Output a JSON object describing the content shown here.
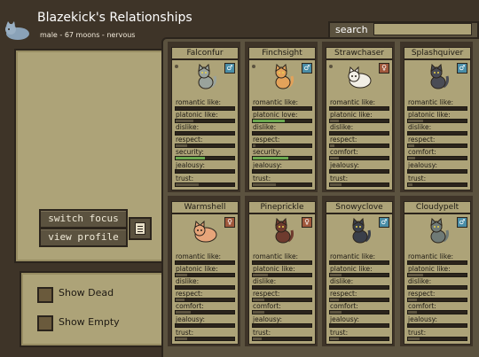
{
  "header": {
    "title": "Blazekick's Relationships",
    "subtitle": "male - 67 moons - nervous"
  },
  "buttons": {
    "switch_focus": "switch focus",
    "view_profile": "view profile"
  },
  "filters": {
    "show_dead": "Show Dead",
    "show_empty": "Show Empty"
  },
  "search": {
    "label": "search",
    "value": ""
  },
  "colors": {
    "bar_empty": "#2b241c",
    "bar_fill": "#5b523f",
    "bar_highlight": "#6aa84f",
    "male": "#4a8da6",
    "female": "#a0583c"
  },
  "cats": [
    {
      "name": "Falconfur",
      "gender": "m",
      "gender_icon": "♂",
      "dot": true,
      "fur": "#9aa39c",
      "sprite": "sitting-cat",
      "relations": [
        {
          "label": "romantic like:",
          "value": 0.0
        },
        {
          "label": "platonic like:",
          "value": 0.3
        },
        {
          "label": "dislike:",
          "value": 0.0
        },
        {
          "label": "respect:",
          "value": 0.2
        },
        {
          "label": "security:",
          "value": 0.5,
          "highlight": true
        },
        {
          "label": "jealousy:",
          "value": 0.0
        },
        {
          "label": "trust:",
          "value": 0.4
        }
      ]
    },
    {
      "name": "Finchsight",
      "gender": "m",
      "gender_icon": "♂",
      "dot": true,
      "fur": "#e3a25a",
      "sprite": "sitting-cat",
      "relations": [
        {
          "label": "romantic like:",
          "value": 0.0
        },
        {
          "label": "platonic love:",
          "value": 0.55,
          "highlight": true
        },
        {
          "label": "dislike:",
          "value": 0.0
        },
        {
          "label": "respect:",
          "value": 0.05
        },
        {
          "label": "security:",
          "value": 0.6,
          "highlight": true
        },
        {
          "label": "jealousy:",
          "value": 0.0
        },
        {
          "label": "trust:",
          "value": 0.4
        }
      ]
    },
    {
      "name": "Strawchaser",
      "gender": "f",
      "gender_icon": "♀",
      "dot": true,
      "fur": "#f2efe6",
      "sprite": "loaf-cat",
      "relations": [
        {
          "label": "romantic like:",
          "value": 0.0
        },
        {
          "label": "platonic like:",
          "value": 0.15
        },
        {
          "label": "dislike:",
          "value": 0.0
        },
        {
          "label": "respect:",
          "value": 0.08
        },
        {
          "label": "comfort:",
          "value": 0.15
        },
        {
          "label": "jealousy:",
          "value": 0.0
        },
        {
          "label": "trust:",
          "value": 0.2
        }
      ]
    },
    {
      "name": "Splashquiver",
      "gender": "m",
      "gender_icon": "♂",
      "dot": false,
      "fur": "#4a4c55",
      "sprite": "sitting-cat",
      "relations": [
        {
          "label": "romantic like:",
          "value": 0.0
        },
        {
          "label": "platonic like:",
          "value": 0.25
        },
        {
          "label": "dislike:",
          "value": 0.0
        },
        {
          "label": "respect:",
          "value": 0.1
        },
        {
          "label": "comfort:",
          "value": 0.12
        },
        {
          "label": "jealousy:",
          "value": 0.0
        },
        {
          "label": "trust:",
          "value": 0.08
        }
      ]
    },
    {
      "name": "Warmshell",
      "gender": "f",
      "gender_icon": "♀",
      "dot": false,
      "fur": "#e7a57a",
      "sprite": "loaf-cat",
      "relations": [
        {
          "label": "romantic like:",
          "value": 0.0
        },
        {
          "label": "platonic like:",
          "value": 0.2
        },
        {
          "label": "dislike:",
          "value": 0.0
        },
        {
          "label": "respect:",
          "value": 0.15
        },
        {
          "label": "comfort:",
          "value": 0.25
        },
        {
          "label": "jealousy:",
          "value": 0.0
        },
        {
          "label": "trust:",
          "value": 0.2
        }
      ]
    },
    {
      "name": "Pineprickle",
      "gender": "f",
      "gender_icon": "♀",
      "dot": false,
      "fur": "#6e3b2e",
      "sprite": "sitting-cat",
      "relations": [
        {
          "label": "romantic like:",
          "value": 0.0
        },
        {
          "label": "platonic like:",
          "value": 0.25
        },
        {
          "label": "dislike:",
          "value": 0.0
        },
        {
          "label": "respect:",
          "value": 0.2
        },
        {
          "label": "comfort:",
          "value": 0.2
        },
        {
          "label": "jealousy:",
          "value": 0.0
        },
        {
          "label": "trust:",
          "value": 0.15
        }
      ]
    },
    {
      "name": "Snowyclove",
      "gender": "m",
      "gender_icon": "♂",
      "dot": false,
      "fur": "#3a3f4a",
      "sprite": "sitting-cat",
      "relations": [
        {
          "label": "romantic like:",
          "value": 0.0
        },
        {
          "label": "platonic like:",
          "value": 0.2
        },
        {
          "label": "dislike:",
          "value": 0.0
        },
        {
          "label": "respect:",
          "value": 0.15
        },
        {
          "label": "comfort:",
          "value": 0.2
        },
        {
          "label": "jealousy:",
          "value": 0.0
        },
        {
          "label": "trust:",
          "value": 0.15
        }
      ]
    },
    {
      "name": "Cloudypelt",
      "gender": "m",
      "gender_icon": "♂",
      "dot": false,
      "fur": "#6f7a76",
      "sprite": "sitting-cat",
      "relations": [
        {
          "label": "romantic like:",
          "value": 0.0
        },
        {
          "label": "platonic like:",
          "value": 0.25
        },
        {
          "label": "dislike:",
          "value": 0.0
        },
        {
          "label": "respect:",
          "value": 0.15
        },
        {
          "label": "comfort:",
          "value": 0.15
        },
        {
          "label": "jealousy:",
          "value": 0.0
        },
        {
          "label": "trust:",
          "value": 0.2
        }
      ]
    }
  ]
}
